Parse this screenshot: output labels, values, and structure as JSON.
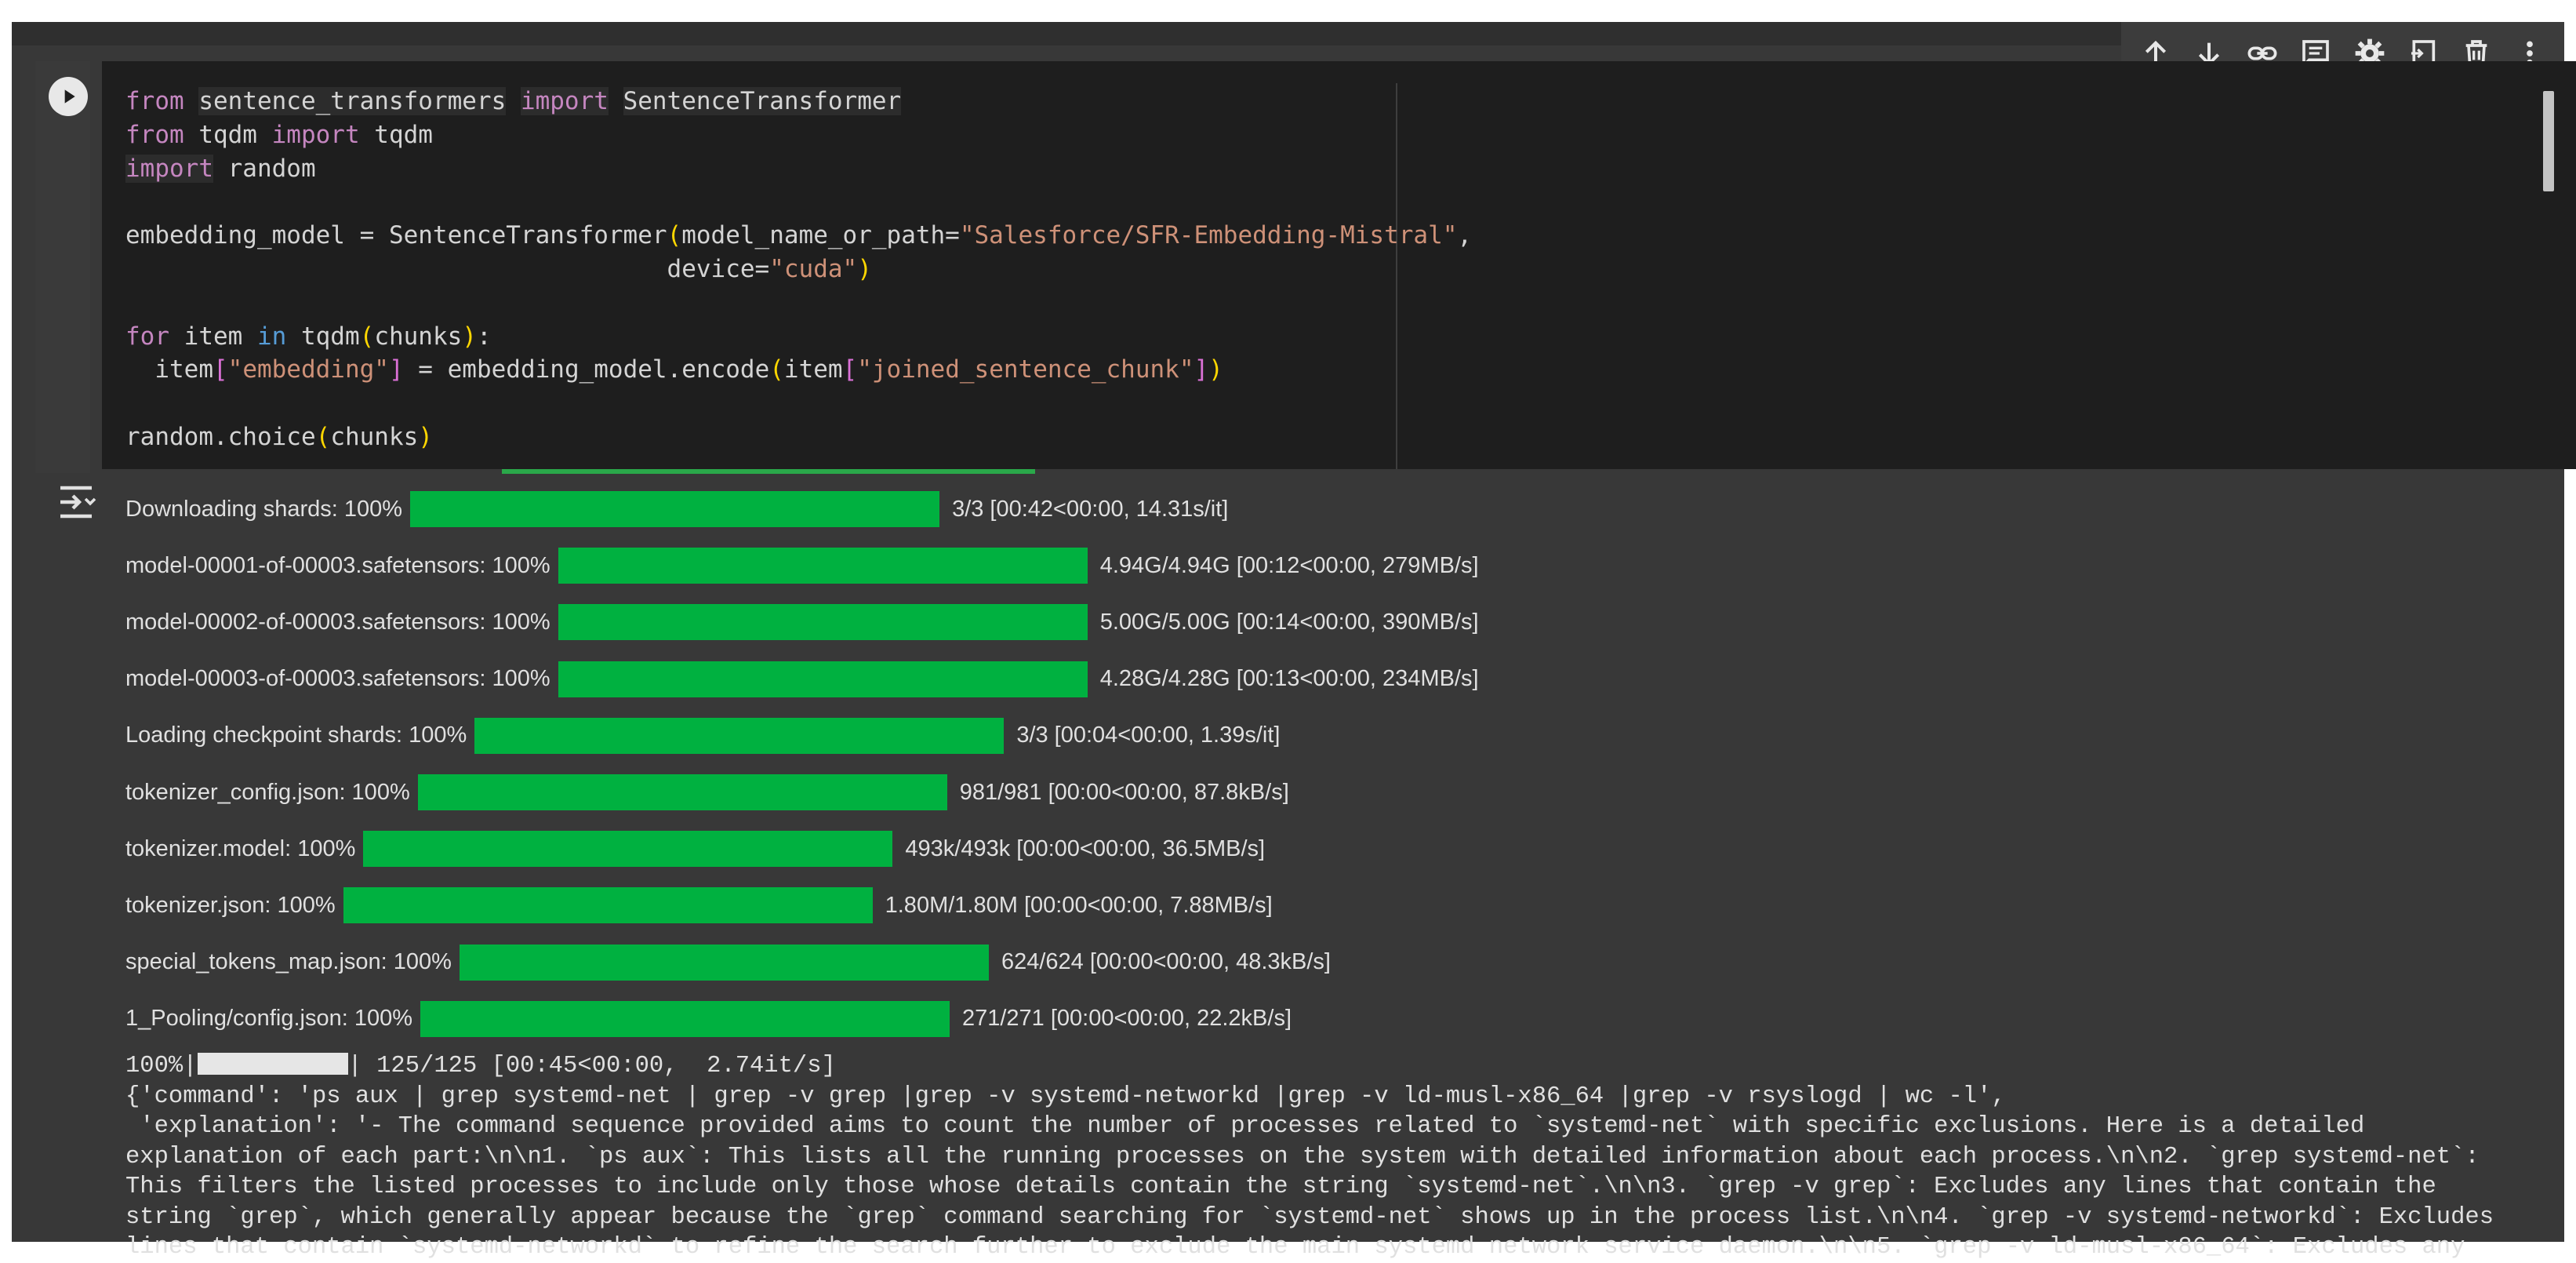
{
  "toolbar": {
    "items": [
      "move-up-icon",
      "move-down-icon",
      "link-icon",
      "comment-icon",
      "gear-icon",
      "mirror-cell-icon",
      "delete-icon",
      "more-vert-icon"
    ]
  },
  "code_lines": [
    "from sentence_transformers import SentenceTransformer",
    "from tqdm import tqdm",
    "import random",
    "",
    "embedding_model = SentenceTransformer(model_name_or_path=\"Salesforce/SFR-Embedding-Mistral\",",
    "                                     device=\"cuda\")",
    "",
    "for item in tqdm(chunks):",
    "  item[\"embedding\"] = embedding_model.encode(item[\"joined_sentence_chunk\"])",
    "",
    "random.choice(chunks)"
  ],
  "progress_rows": [
    {
      "label": "Downloading shards: 100%",
      "stats": "3/3 [00:42<00:00, 14.31s/it]",
      "progress": 1.0
    },
    {
      "label": "model-00001-of-00003.safetensors: 100%",
      "stats": "4.94G/4.94G [00:12<00:00, 279MB/s]",
      "progress": 1.0
    },
    {
      "label": "model-00002-of-00003.safetensors: 100%",
      "stats": "5.00G/5.00G [00:14<00:00, 390MB/s]",
      "progress": 1.0
    },
    {
      "label": "model-00003-of-00003.safetensors: 100%",
      "stats": "4.28G/4.28G [00:13<00:00, 234MB/s]",
      "progress": 1.0
    },
    {
      "label": "Loading checkpoint shards: 100%",
      "stats": "3/3 [00:04<00:00,  1.39s/it]",
      "progress": 1.0
    },
    {
      "label": "tokenizer_config.json: 100%",
      "stats": "981/981 [00:00<00:00, 87.8kB/s]",
      "progress": 1.0
    },
    {
      "label": "tokenizer.model: 100%",
      "stats": "493k/493k [00:00<00:00, 36.5MB/s]",
      "progress": 1.0
    },
    {
      "label": "tokenizer.json: 100%",
      "stats": "1.80M/1.80M [00:00<00:00, 7.88MB/s]",
      "progress": 1.0
    },
    {
      "label": "special_tokens_map.json: 100%",
      "stats": "624/624 [00:00<00:00, 48.3kB/s]",
      "progress": 1.0
    },
    {
      "label": "1_Pooling/config.json: 100%",
      "stats": "271/271 [00:00<00:00, 22.2kB/s]",
      "progress": 1.0
    }
  ],
  "tqdm_line": {
    "prefix": "100%|",
    "suffix": "| 125/125 [00:45<00:00,  2.74it/s]"
  },
  "raw_output_lines": [
    "{'command': 'ps aux | grep systemd-net | grep -v grep |grep -v systemd-networkd |grep -v ld-musl-x86_64 |grep -v rsyslogd | wc -l',",
    " 'explanation': '- The command sequence provided aims to count the number of processes related to `systemd-net` with specific exclusions. Here is a detailed",
    "explanation of each part:\\n\\n1. `ps aux`: This lists all the running processes on the system with detailed information about each process.\\n\\n2. `grep systemd-net`:",
    "This filters the listed processes to include only those whose details contain the string `systemd-net`.\\n\\n3. `grep -v grep`: Excludes any lines that contain the",
    "string `grep`, which generally appear because the `grep` command searching for `systemd-net` shows up in the process list.\\n\\n4. `grep -v systemd-networkd`: Excludes",
    "lines that contain `systemd-networkd` to refine the search further to exclude the main systemd network service daemon.\\n\\n5. `grep -v ld-musl-x86_64`: Excludes any"
  ]
}
